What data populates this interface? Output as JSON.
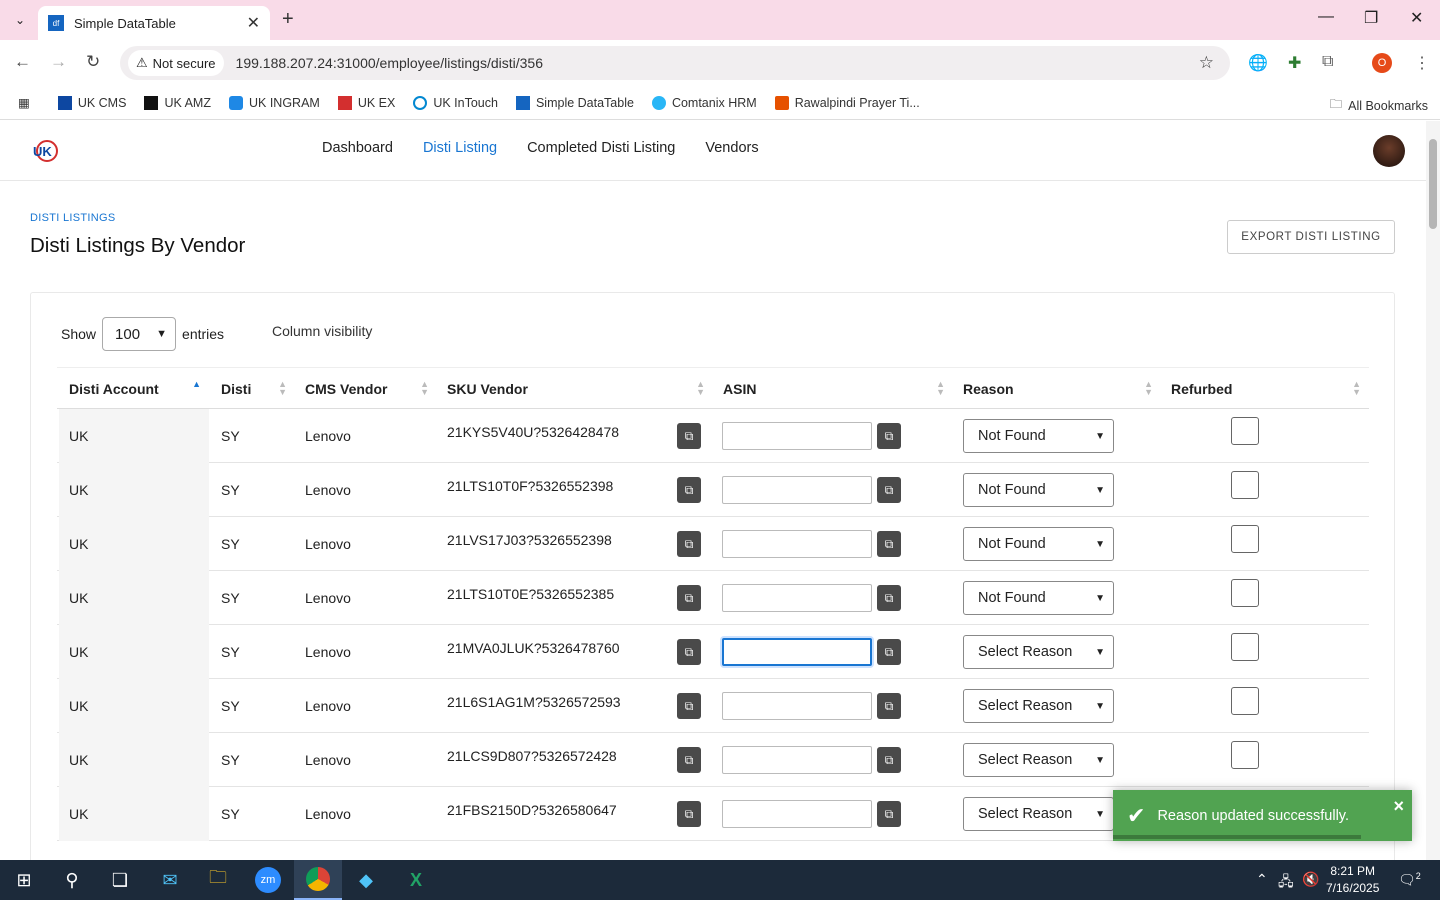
{
  "browser": {
    "tab_title": "Simple DataTable",
    "tab_favicon": "df",
    "security_label": "Not secure",
    "url": "199.188.207.24:31000/employee/listings/disti/356",
    "profile_initial": "O",
    "bookmarks": [
      {
        "label": "UK CMS",
        "icon": "uk-cms-icon",
        "color": "#0d47a1"
      },
      {
        "label": "UK AMZ",
        "icon": "amazon-icon",
        "color": "#111111"
      },
      {
        "label": "UK INGRAM",
        "icon": "ingram-icon",
        "color": "#1e88e5"
      },
      {
        "label": "UK EX",
        "icon": "ex-icon",
        "color": "#d32f2f"
      },
      {
        "label": "UK InTouch",
        "icon": "intouch-icon",
        "color": "#0288d1"
      },
      {
        "label": "Simple DataTable",
        "icon": "datatable-icon",
        "color": "#1565c0"
      },
      {
        "label": "Comtanix HRM",
        "icon": "hrm-icon",
        "color": "#29b6f6"
      },
      {
        "label": "Rawalpindi Prayer Ti...",
        "icon": "prayer-icon",
        "color": "#e65100"
      }
    ],
    "all_bookmarks_label": "All Bookmarks"
  },
  "app": {
    "nav": [
      "Dashboard",
      "Disti Listing",
      "Completed Disti Listing",
      "Vendors"
    ],
    "active_nav": "Disti Listing",
    "accent": "#1976d2"
  },
  "page": {
    "breadcrumb": "DISTI LISTINGS",
    "title": "Disti Listings By Vendor",
    "export_label": "EXPORT DISTI LISTING",
    "show_label": "Show",
    "entries_value": "100",
    "entries_label": "entries",
    "column_visibility_label": "Column visibility"
  },
  "table": {
    "headers": [
      "Disti Account",
      "Disti",
      "CMS Vendor",
      "SKU Vendor",
      "ASIN",
      "Reason",
      "Refurbed"
    ],
    "rows": [
      {
        "account": "UK",
        "disti": "SY",
        "vendor": "Lenovo",
        "sku": "21KYS5V40U?5326428478",
        "asin": "",
        "reason": "Not Found",
        "refurbed": false
      },
      {
        "account": "UK",
        "disti": "SY",
        "vendor": "Lenovo",
        "sku": "21LTS10T0F?5326552398",
        "asin": "",
        "reason": "Not Found",
        "refurbed": false
      },
      {
        "account": "UK",
        "disti": "SY",
        "vendor": "Lenovo",
        "sku": "21LVS17J03?5326552398",
        "asin": "",
        "reason": "Not Found",
        "refurbed": false
      },
      {
        "account": "UK",
        "disti": "SY",
        "vendor": "Lenovo",
        "sku": "21LTS10T0E?5326552385",
        "asin": "",
        "reason": "Not Found",
        "refurbed": false
      },
      {
        "account": "UK",
        "disti": "SY",
        "vendor": "Lenovo",
        "sku": "21MVA0JLUK?5326478760",
        "asin": "",
        "reason": "Select Reason",
        "refurbed": false,
        "focused": true
      },
      {
        "account": "UK",
        "disti": "SY",
        "vendor": "Lenovo",
        "sku": "21L6S1AG1M?5326572593",
        "asin": "",
        "reason": "Select Reason",
        "refurbed": false
      },
      {
        "account": "UK",
        "disti": "SY",
        "vendor": "Lenovo",
        "sku": "21LCS9D807?5326572428",
        "asin": "",
        "reason": "Select Reason",
        "refurbed": false
      },
      {
        "account": "UK",
        "disti": "SY",
        "vendor": "Lenovo",
        "sku": "21FBS2150D?5326580647",
        "asin": "",
        "reason": "Select Reason",
        "refurbed": false
      }
    ]
  },
  "toast": {
    "message": "Reason updated successfully.",
    "color": "#51a351"
  },
  "taskbar": {
    "time": "8:21 PM",
    "date": "7/16/2025",
    "notification_count": "2"
  }
}
